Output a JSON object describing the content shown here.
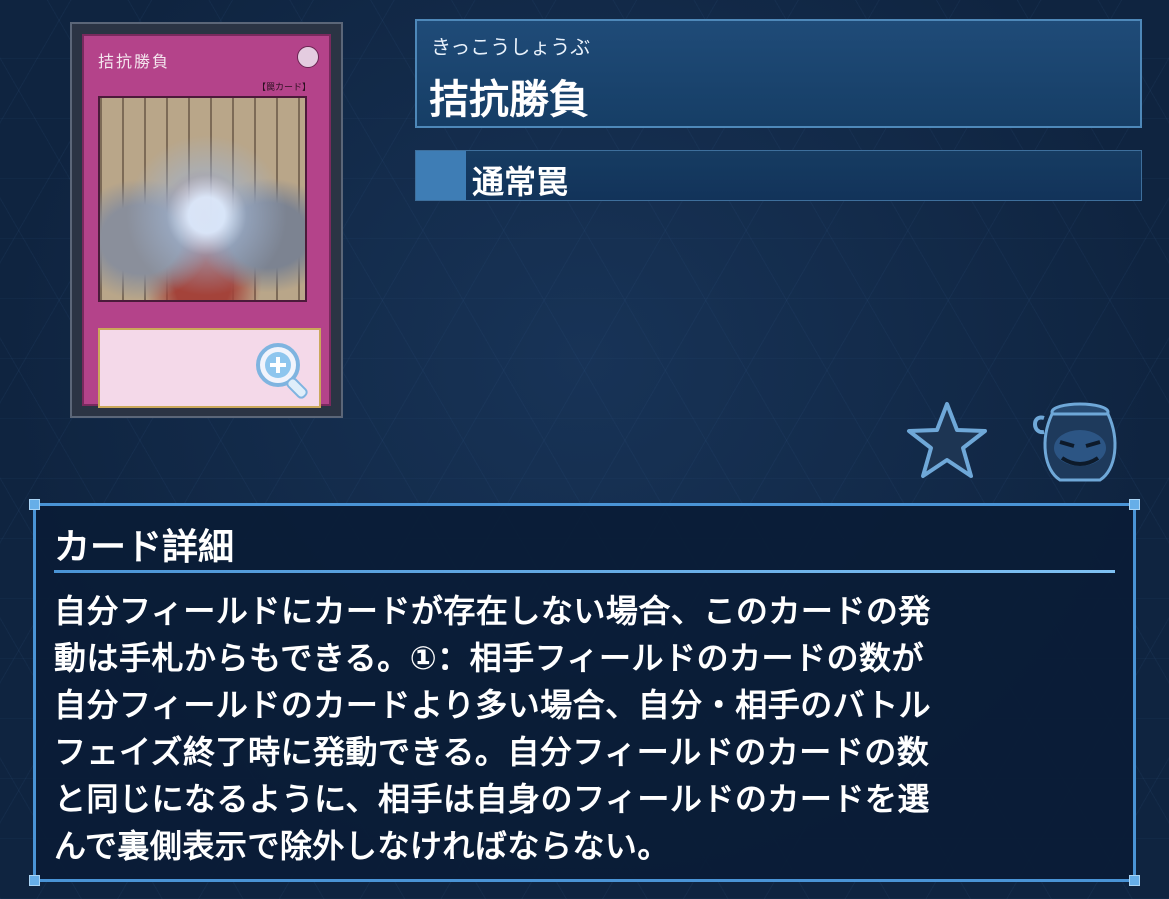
{
  "card": {
    "name": "拮抗勝負",
    "ruby": "きっこうしょうぶ",
    "type_line": "【罠カード】",
    "type": "通常罠",
    "frame_color": "#b4438a",
    "type_color": "#3e7db5"
  },
  "icons": {
    "zoom": "zoom-in-magnifier-icon",
    "favorite": "star-icon",
    "pot": "pot-of-greed-icon"
  },
  "details": {
    "heading": "カード詳細",
    "lines": [
      "自分フィールドにカードが存在しない場合、このカードの発",
      "動は手札からもできる。①：相手フィールドのカードの数が",
      "自分フィールドのカードより多い場合、自分・相手のバトル",
      "フェイズ終了時に発動できる。自分フィールドのカードの数",
      "と同じになるように、相手は自身のフィールドのカードを選",
      "んで裏側表示で除外しなければならない。"
    ]
  }
}
